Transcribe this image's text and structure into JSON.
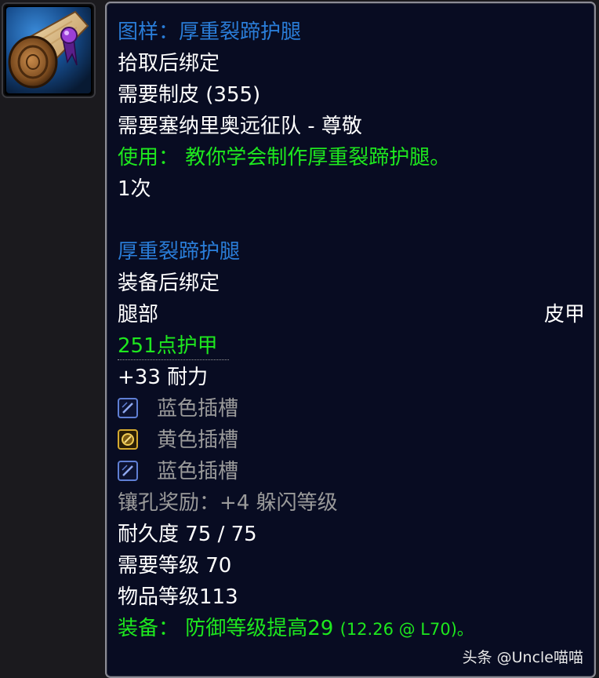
{
  "item_icon": "recipe-scroll-icon",
  "colors": {
    "tooltip_bg": "#080c22",
    "recipe_title": "#2a7dd8",
    "use_effect": "#1ee81e",
    "socket_text": "#9a9a9a",
    "blue_socket": "#5f7fd4",
    "yellow_socket": "#d4a92f"
  },
  "tooltip": {
    "recipe_title": "图样：厚重裂蹄护腿",
    "bind_on_pickup": "拾取后绑定",
    "req_profession": "需要制皮 (355)",
    "req_reputation": "需要塞纳里奥远征队 - 尊敬",
    "use_effect": "使用：  教你学会制作厚重裂蹄护腿。",
    "charges": "1次",
    "item_name": "厚重裂蹄护腿",
    "bind_on_equip": "装备后绑定",
    "slot": "腿部",
    "armor_type": "皮甲",
    "armor": "251点护甲",
    "stamina": "+33 耐力",
    "sockets": [
      {
        "label": "蓝色插槽",
        "color": "blue",
        "icon": "blue-socket-icon"
      },
      {
        "label": "黄色插槽",
        "color": "yellow",
        "icon": "yellow-socket-icon"
      },
      {
        "label": "蓝色插槽",
        "color": "blue",
        "icon": "blue-socket-icon"
      }
    ],
    "socket_bonus": "镶孔奖励：+4 躲闪等级",
    "durability": "耐久度 75 / 75",
    "req_level": "需要等级 70",
    "item_level": "物品等级113",
    "equip_effect": "装备：  防御等级提高29",
    "equip_effect_detail": "(12.26 @ L70)。"
  },
  "watermark": "头条 @Uncle喵喵"
}
